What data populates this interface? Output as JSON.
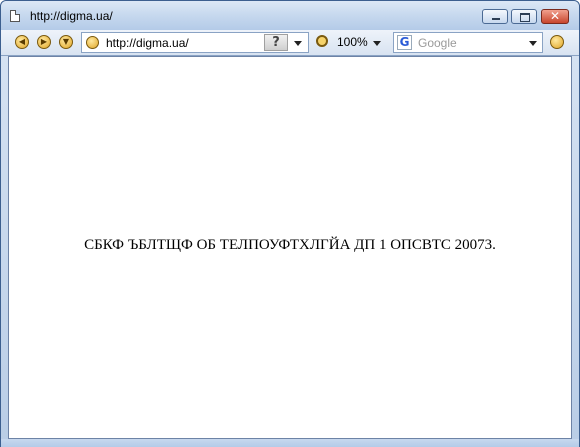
{
  "window": {
    "title": "http://digma.ua/"
  },
  "toolbar": {
    "address_url": "http://digma.ua/",
    "help_glyph": "?",
    "zoom_level": "100%",
    "search_placeholder": "Google",
    "search_engine_glyph": "G"
  },
  "content": {
    "message": "СБКФ ЪБЛТЩФ ОБ ТЕЛПОУФТХЛГЙА ДП 1 ОПСВТС 20073."
  },
  "icons": {
    "back": "back-icon",
    "forward": "forward-icon",
    "menu": "dropdown-icon",
    "site": "site-icon",
    "zoom": "zoom-icon",
    "go": "go-icon"
  },
  "colors": {
    "frame": "#b9cde6",
    "close": "#c8452d",
    "content_bg": "#ffffff"
  }
}
